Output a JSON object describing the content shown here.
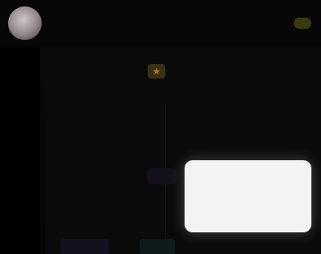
{
  "topbar": {
    "title": "",
    "subtitle": ""
  },
  "main": {
    "header": "",
    "rows": [
      "",
      "",
      "",
      "",
      ""
    ]
  },
  "popup": {
    "text": ""
  },
  "colors": {
    "background": "#000000",
    "panel": "#0a0a0a",
    "accent_gold": "#a07a2a",
    "popup": "#f3f3f3"
  },
  "icons": {
    "star": "star-icon"
  }
}
